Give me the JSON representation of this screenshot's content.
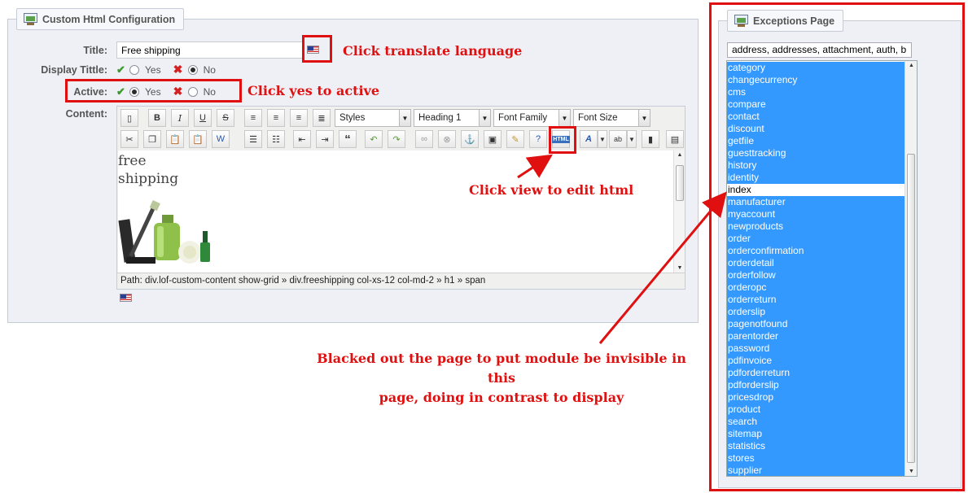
{
  "config_panel": {
    "legend": "Custom Html Configuration",
    "title_label": "Title:",
    "title_value": "Free shipping",
    "display_title_label": "Display Tittle:",
    "active_label": "Active:",
    "yes": "Yes",
    "no": "No",
    "display_title_selected": "No",
    "active_selected": "Yes",
    "content_label": "Content:"
  },
  "editor": {
    "styles": "Styles",
    "heading": "Heading 1",
    "font_family": "Font Family",
    "font_size": "Font Size",
    "content_line1": "free",
    "content_line2": "shipping",
    "path": "Path: div.lof-custom-content show-grid » div.freeshipping col-xs-12 col-md-2 » h1 » span",
    "html_button": "HTML"
  },
  "exceptions_panel": {
    "legend": "Exceptions Page",
    "input_value": "address, addresses, attachment, auth, b",
    "items": [
      "category",
      "changecurrency",
      "cms",
      "compare",
      "contact",
      "discount",
      "getfile",
      "guesttracking",
      "history",
      "identity",
      "index",
      "manufacturer",
      "myaccount",
      "newproducts",
      "order",
      "orderconfirmation",
      "orderdetail",
      "orderfollow",
      "orderopc",
      "orderreturn",
      "orderslip",
      "pagenotfound",
      "parentorder",
      "password",
      "pdfinvoice",
      "pdforderreturn",
      "pdforderslip",
      "pricesdrop",
      "product",
      "search",
      "sitemap",
      "statistics",
      "stores",
      "supplier"
    ],
    "unselected_item": "index"
  },
  "annotations": {
    "translate": "Click translate language",
    "active": "Click yes to active",
    "edit_html": "Click view to edit html",
    "exceptions_line1": "Blacked out the page to put module be invisible in this",
    "exceptions_line2": "page, doing in contrast to display"
  },
  "colors": {
    "annotation": "#e01010",
    "selection": "#3399ff",
    "panel_bg": "#eef0f6"
  },
  "icons": [
    "legend-icon",
    "flag-us-icon",
    "check-icon",
    "x-icon",
    "html-source-icon"
  ]
}
